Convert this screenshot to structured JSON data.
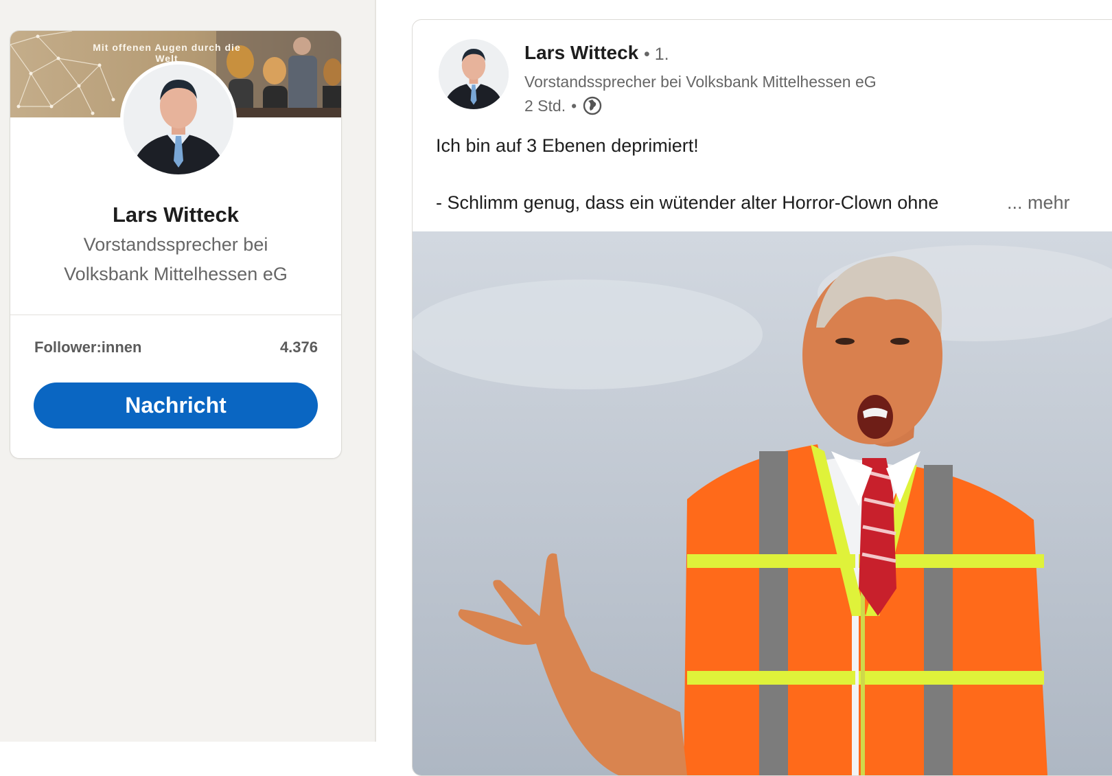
{
  "profile_card": {
    "cover_text": "Mit offenen Augen durch die Welt",
    "name": "Lars Witteck",
    "headline": "Vorstandssprecher bei Volksbank Mittelhessen eG",
    "follower_label": "Follower:innen",
    "follower_count": "4.376",
    "message_button": "Nachricht"
  },
  "post": {
    "author_name": "Lars Witteck",
    "author_degree": "• 1.",
    "author_headline": "Vorstandssprecher bei Volksbank Mittelhessen eG",
    "time": "2 Std.",
    "visibility_icon": "globe-icon",
    "more_options": "···",
    "text_line_1": "Ich bin auf 3 Ebenen deprimiert!",
    "text_line_2": "- Schlimm genug, dass ein wütender alter Horror-Clown ohne",
    "more_link": "... mehr"
  },
  "colors": {
    "accent": "#0a66c2",
    "page_background": "#f3f2ef",
    "vest_orange": "#ff6a1a",
    "vest_reflective": "#dff23a"
  }
}
